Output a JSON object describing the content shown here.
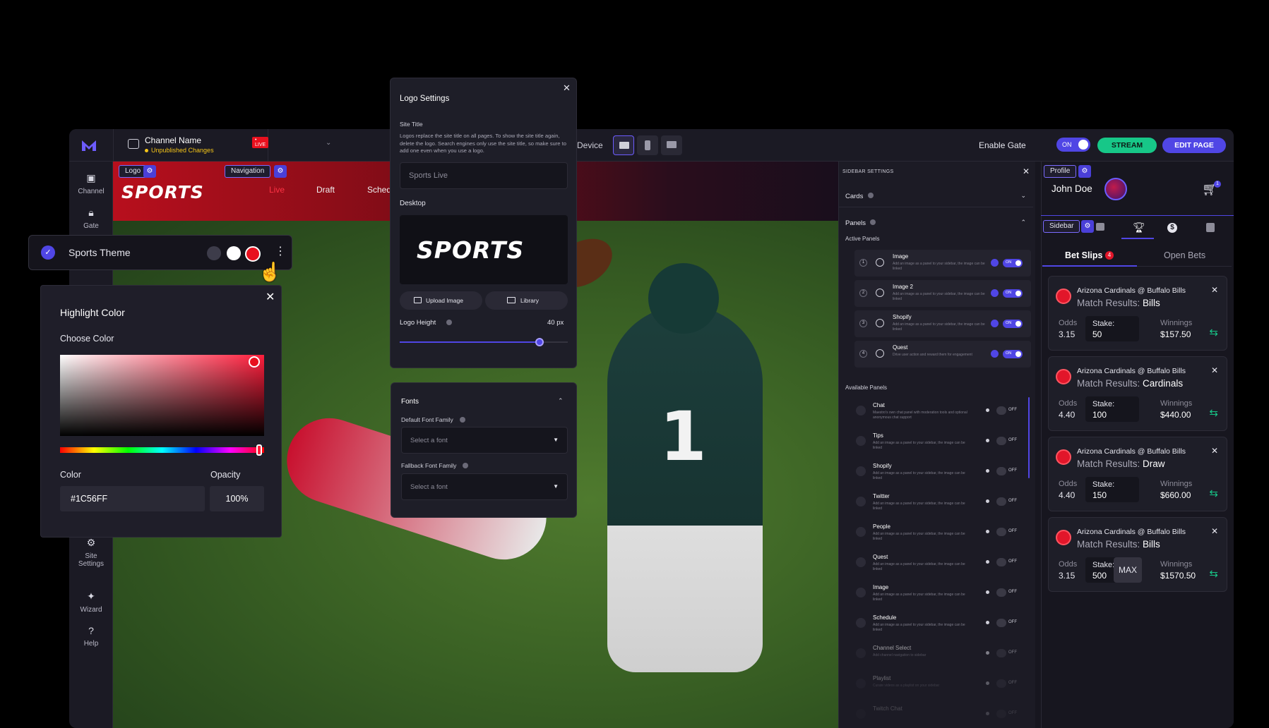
{
  "topbar": {
    "channel_name": "Channel Name",
    "live_badge": "• LIVE",
    "unpublished": "Unpublished Changes",
    "device_label": "Device",
    "enable_gate": "Enable Gate",
    "gate_toggle": "ON",
    "stream_button": "STREAM",
    "edit_page_button": "EDIT PAGE"
  },
  "leftnav": {
    "items": [
      {
        "label": "Channel",
        "icon": "channel-icon"
      },
      {
        "label": "Gate",
        "icon": "lock-icon"
      },
      {
        "label": "Site Settings",
        "icon": "gear-icon"
      },
      {
        "label": "Wizard",
        "icon": "sparkle-icon"
      },
      {
        "label": "Help",
        "icon": "question-icon"
      }
    ]
  },
  "canvas": {
    "logo_tag": "Logo",
    "navigation_tag": "Navigation",
    "logo_text": "SPORTS",
    "nav_items": [
      "Live",
      "Draft",
      "Sched"
    ]
  },
  "theme_bar": {
    "label": "Sports Theme",
    "swatches": [
      "#3d3c4a",
      "#ffffff",
      "#e8101e"
    ]
  },
  "highlight_color": {
    "title": "Highlight Color",
    "choose_label": "Choose Color",
    "color_label": "Color",
    "opacity_label": "Opacity",
    "color_value": "#1C56FF",
    "opacity_value": "100%"
  },
  "logo_settings": {
    "title": "Logo Settings",
    "site_title_label": "Site Title",
    "description": "Logos replace the site title on all pages. To show the site title again, delete the logo. Search engines only use the site title, so make sure to add one even when you use a logo.",
    "site_title_value": "Sports Live",
    "desktop_label": "Desktop",
    "preview_text": "SPORTS",
    "upload_button": "Upload Image",
    "library_button": "Library",
    "logo_height_label": "Logo Height",
    "logo_height_value": "40 px",
    "logo_height_fraction": 0.83
  },
  "fonts": {
    "title": "Fonts",
    "default_label": "Default Font Family",
    "default_placeholder": "Select a font",
    "fallback_label": "Fallback Font Family",
    "fallback_placeholder": "Select a font"
  },
  "sidebar_settings": {
    "title": "SIDEBAR SETTINGS",
    "cards_label": "Cards",
    "panels_label": "Panels",
    "active_panels_label": "Active Panels",
    "active": [
      {
        "num": "1",
        "name": "Image",
        "desc": "Add an image as a panel to your sidebar, the image can be linked",
        "state": "ON"
      },
      {
        "num": "2",
        "name": "Image 2",
        "desc": "Add an image as a panel to your sidebar, the image can be linked",
        "state": "ON"
      },
      {
        "num": "3",
        "name": "Shopify",
        "desc": "Add an image as a panel to your sidebar, the image can be linked",
        "state": "ON"
      },
      {
        "num": "4",
        "name": "Quest",
        "desc": "Drive user action and reward them for engagement",
        "state": "ON"
      }
    ],
    "available_label": "Available Panels",
    "available": [
      {
        "name": "Chat",
        "desc": "Maestro's own chat panel with moderation tools and optional anonymous chat support",
        "state": "OFF"
      },
      {
        "name": "Tips",
        "desc": "Add an image as a panel to your sidebar, the image can be linked",
        "state": "OFF"
      },
      {
        "name": "Shopify",
        "desc": "Add an image as a panel to your sidebar, the image can be linked",
        "state": "OFF"
      },
      {
        "name": "Twitter",
        "desc": "Add an image as a panel to your sidebar, the image can be linked",
        "state": "OFF"
      },
      {
        "name": "People",
        "desc": "Add an image as a panel to your sidebar, the image can be linked",
        "state": "OFF"
      },
      {
        "name": "Quest",
        "desc": "Add an image as a panel to your sidebar, the image can be linked",
        "state": "OFF"
      },
      {
        "name": "Image",
        "desc": "Add an image as a panel to your sidebar, the image can be linked",
        "state": "OFF"
      },
      {
        "name": "Schedule",
        "desc": "Add an image as a panel to your sidebar, the image can be linked",
        "state": "OFF"
      },
      {
        "name": "Channel Select",
        "desc": "Add channel navigation to sidebar",
        "state": "OFF"
      },
      {
        "name": "Playlist",
        "desc": "Curate videos as a playlist on your sidebar",
        "state": "OFF"
      },
      {
        "name": "Twitch Chat",
        "desc": "",
        "state": "OFF"
      }
    ]
  },
  "right_sidebar": {
    "profile_tag": "Profile",
    "sidebar_tag": "Sidebar",
    "user_name": "John Doe",
    "cart_count": "1",
    "tabs": [
      "Bet Slips",
      "Open Bets"
    ],
    "bet_slips_count": "4",
    "odds_label": "Odds",
    "stake_label": "Stake:",
    "winnings_label": "Winnings",
    "result_label": "Match Results:",
    "max_label": "MAX",
    "bets": [
      {
        "match": "Arizona Cardinals @ Buffalo Bills",
        "result": "Bills",
        "odds": "3.15",
        "stake": "50",
        "winnings": "$157.50"
      },
      {
        "match": "Arizona Cardinals @ Buffalo Bills",
        "result": "Cardinals",
        "odds": "4.40",
        "stake": "100",
        "winnings": "$440.00"
      },
      {
        "match": "Arizona Cardinals @ Buffalo Bills",
        "result": "Draw",
        "odds": "4.40",
        "stake": "150",
        "winnings": "$660.00"
      },
      {
        "match": "Arizona Cardinals @ Buffalo Bills",
        "result": "Bills",
        "odds": "3.15",
        "stake": "500",
        "winnings": "$1570.50"
      }
    ]
  },
  "colors": {
    "accent": "#5046e5",
    "stream_green": "#17c788",
    "sports_red": "#e8101e"
  }
}
